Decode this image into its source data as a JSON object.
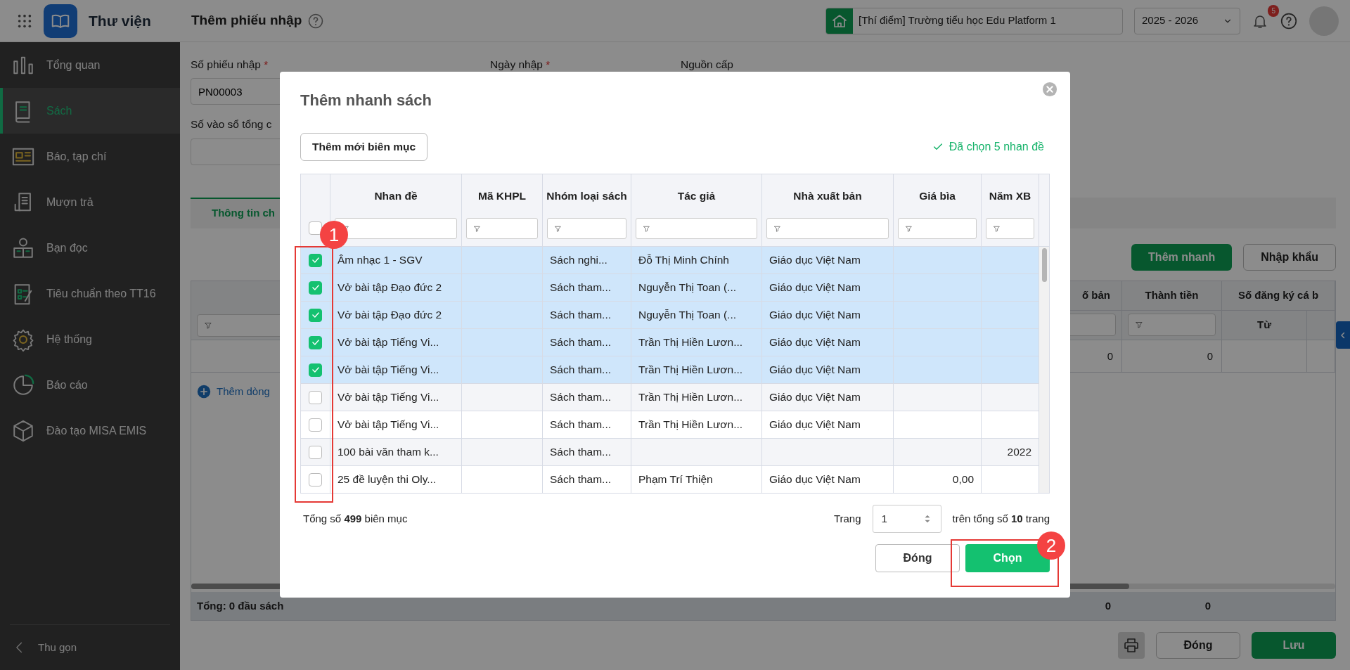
{
  "app": {
    "title": "Thư viện"
  },
  "header": {
    "page_title": "Thêm phiếu nhập",
    "school": "[Thí điểm] Trường tiểu học Edu Platform 1",
    "year": "2025 - 2026",
    "notification_count": "5"
  },
  "sidebar": {
    "items": [
      {
        "label": "Tổng quan",
        "selected": false
      },
      {
        "label": "Sách",
        "selected": true
      },
      {
        "label": "Báo, tạp chí",
        "selected": false
      },
      {
        "label": "Mượn trả",
        "selected": false
      },
      {
        "label": "Bạn đọc",
        "selected": false
      },
      {
        "label": "Tiêu chuẩn theo TT16",
        "selected": false
      },
      {
        "label": "Hệ thống",
        "selected": false
      },
      {
        "label": "Báo cáo",
        "selected": false
      },
      {
        "label": "Đào tạo MISA EMIS",
        "selected": false
      }
    ],
    "collapse": "Thu gọn"
  },
  "form": {
    "fields": [
      {
        "label": "Số phiếu nhập",
        "required_mark": "*",
        "value": "PN00003"
      },
      {
        "label": "Ngày nhập",
        "required_mark": "*"
      },
      {
        "label": "Nguồn cấp"
      },
      {
        "label": "Số vào sổ tổng c"
      }
    ]
  },
  "tabs": [
    {
      "label": "Thông tin ch",
      "selected": true
    }
  ],
  "detail_buttons": [
    {
      "label": "Thêm nhanh",
      "kind": "primary"
    },
    {
      "label": "Nhập khẩu",
      "kind": "outline"
    }
  ],
  "detail_table": {
    "columns": [
      "ố bản",
      "Thành tiền",
      "Số đăng ký cá b"
    ],
    "subcolumns": [
      "Từ"
    ],
    "rows": [
      [
        "0",
        "0"
      ]
    ],
    "add_row": "Thêm dòng",
    "footer": {
      "label": "Tổng: 0 đầu sách",
      "values": [
        "0",
        "0"
      ]
    }
  },
  "footer_buttons": [
    {
      "label": "Đóng",
      "kind": "outline"
    },
    {
      "label": "Lưu",
      "kind": "primary"
    }
  ],
  "modal": {
    "title": "Thêm nhanh sách",
    "add_button": "Thêm mới biên mục",
    "selected_note": "Đã chọn 5 nhan đề",
    "select_all": false,
    "columns": [
      "Nhan đề",
      "Mã KHPL",
      "Nhóm loại sách",
      "Tác giả",
      "Nhà xuất bản",
      "Giá bìa",
      "Năm XB"
    ],
    "rows": [
      {
        "checked": true,
        "cells": [
          "Âm nhạc 1 - SGV",
          "",
          "Sách nghi...",
          "Đỗ Thị Minh Chính",
          "Giáo dục Việt Nam",
          "",
          ""
        ]
      },
      {
        "checked": true,
        "cells": [
          "Vở bài tập Đạo đức 2",
          "",
          "Sách tham...",
          "Nguyễn Thị Toan (...",
          "Giáo dục Việt Nam",
          "",
          ""
        ]
      },
      {
        "checked": true,
        "cells": [
          "Vở bài tập Đạo đức 2",
          "",
          "Sách tham...",
          "Nguyễn Thị Toan (...",
          "Giáo dục Việt Nam",
          "",
          ""
        ]
      },
      {
        "checked": true,
        "cells": [
          "Vở bài tập Tiếng Vi...",
          "",
          "Sách tham...",
          "Trần Thị Hiền Lươn...",
          "Giáo dục Việt Nam",
          "",
          ""
        ]
      },
      {
        "checked": true,
        "cells": [
          "Vở bài tập Tiếng Vi...",
          "",
          "Sách tham...",
          "Trần Thị Hiền Lươn...",
          "Giáo dục Việt Nam",
          "",
          ""
        ]
      },
      {
        "checked": false,
        "cells": [
          "Vở bài tập Tiếng Vi...",
          "",
          "Sách tham...",
          "Trần Thị Hiền Lươn...",
          "Giáo dục Việt Nam",
          "",
          ""
        ]
      },
      {
        "checked": false,
        "cells": [
          "Vở bài tập Tiếng Vi...",
          "",
          "Sách tham...",
          "Trần Thị Hiền Lươn...",
          "Giáo dục Việt Nam",
          "",
          ""
        ]
      },
      {
        "checked": false,
        "cells": [
          "100 bài văn tham k...",
          "",
          "Sách tham...",
          "",
          "",
          "",
          "2022"
        ]
      },
      {
        "checked": false,
        "cells": [
          "25 đề luyện thi Oly...",
          "",
          "Sách tham...",
          "Phạm Trí Thiện",
          "Giáo dục Việt Nam",
          "0,00",
          ""
        ]
      }
    ],
    "total": "Tổng số **499** biên mục",
    "page_label": "Trang",
    "page": "1",
    "page_total": "trên tổng số **10** trang",
    "buttons": [
      {
        "label": "Đóng",
        "kind": "outline"
      },
      {
        "label": "Chọn",
        "kind": "primary"
      }
    ]
  },
  "annotations": [
    {
      "label": "1"
    },
    {
      "label": "2"
    }
  ]
}
